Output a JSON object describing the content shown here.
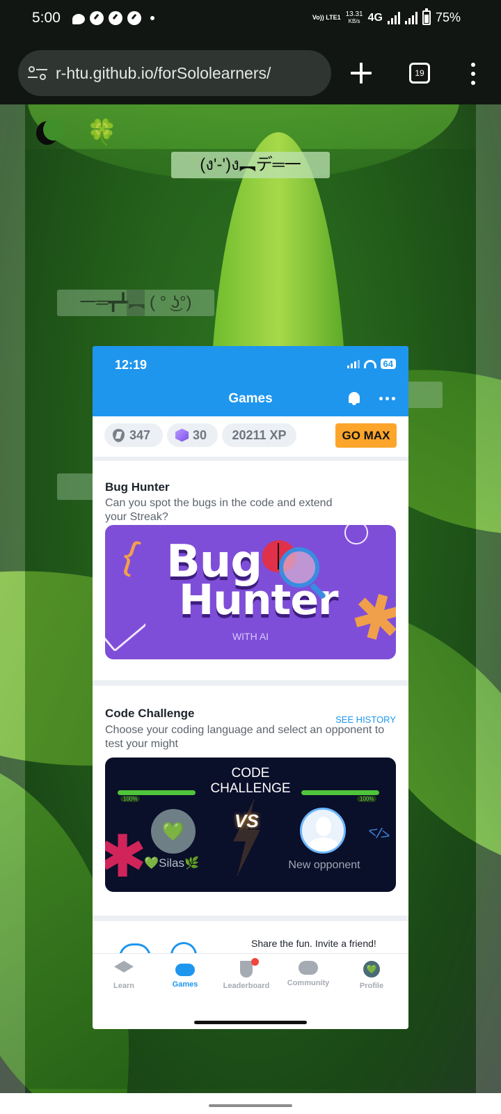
{
  "status_bar": {
    "time": "5:00",
    "volte": "Vo)) LTE1",
    "net_speed": "13.31",
    "net_unit": "KB/s",
    "network": "4G",
    "battery": "75%"
  },
  "browser": {
    "url": "r-htu.github.io/forSololearners/",
    "tab_count": "19"
  },
  "page": {
    "kaomoji_main": "(ง'-')ง︻デ═一",
    "kaomoji_faded": "一═┳┻︻ ( ° ͜ʖ°)"
  },
  "app": {
    "time": "12:19",
    "battery": "64",
    "title": "Games",
    "stats": {
      "bits": "347",
      "gems": "30",
      "xp": "20211 XP"
    },
    "go_max": "GO MAX",
    "bug_hunter": {
      "title": "Bug Hunter",
      "description": "Can you spot the bugs in the code and extend your Streak?",
      "banner_word1": "Bug",
      "banner_word2": "Hunter",
      "banner_sub": "WITH AI"
    },
    "code_challenge": {
      "title": "Code Challenge",
      "see_history": "SEE HISTORY",
      "description": "Choose your coding language and select an opponent to test your might",
      "banner_title": "CODE\nCHALLENGE",
      "hp_left": "100%",
      "hp_right": "100%",
      "vs": "VS",
      "player_name": "💚Silas🌿",
      "opponent_name": "New opponent"
    },
    "invite": "Share the fun. Invite a friend!",
    "tabs": [
      {
        "label": "Learn",
        "icon": "graduation-cap-icon"
      },
      {
        "label": "Games",
        "icon": "gamepad-icon"
      },
      {
        "label": "Leaderboard",
        "icon": "trophy-icon"
      },
      {
        "label": "Community",
        "icon": "chat-bubble-icon"
      },
      {
        "label": "Profile",
        "icon": "profile-avatar-icon"
      }
    ],
    "active_tab": "Games",
    "accent_color": "#1e96ee",
    "gomax_color": "#fca52a"
  }
}
